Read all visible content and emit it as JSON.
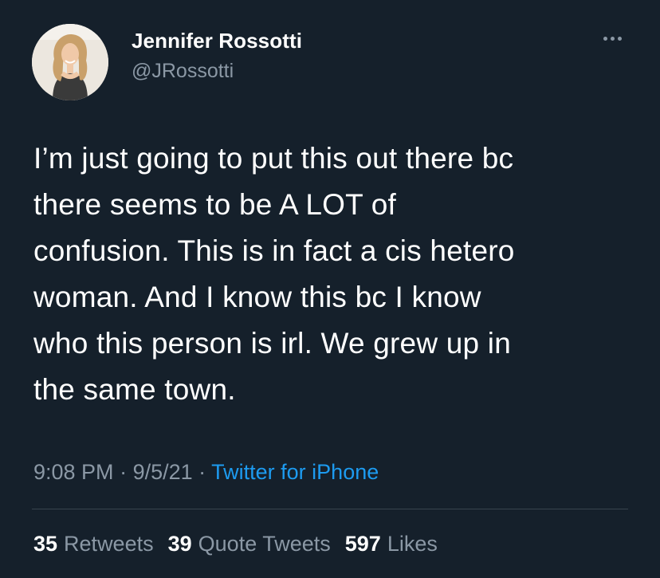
{
  "author": {
    "display_name": "Jennifer Rossotti",
    "handle": "@JRossotti"
  },
  "tweet": {
    "text": "I’m just going to put this out there bc\nthere seems to be A LOT of\nconfusion. This is in fact a cis hetero\nwoman. And I know this bc I know\nwho this person is irl. We grew up in\nthe same town.",
    "time": "9:08 PM",
    "separator1": " · ",
    "date": "9/5/21",
    "separator2": " · ",
    "source": "Twitter for iPhone"
  },
  "stats": {
    "retweets_count": "35",
    "retweets_label": "Retweets",
    "quotes_count": "39",
    "quotes_label": "Quote Tweets",
    "likes_count": "597",
    "likes_label": "Likes"
  },
  "icons": {
    "more": "more-horizontal-icon"
  },
  "colors": {
    "background": "#15202b",
    "text": "#ffffff",
    "secondary": "#8b98a5",
    "link": "#1d9bf0",
    "divider": "#38444d"
  }
}
